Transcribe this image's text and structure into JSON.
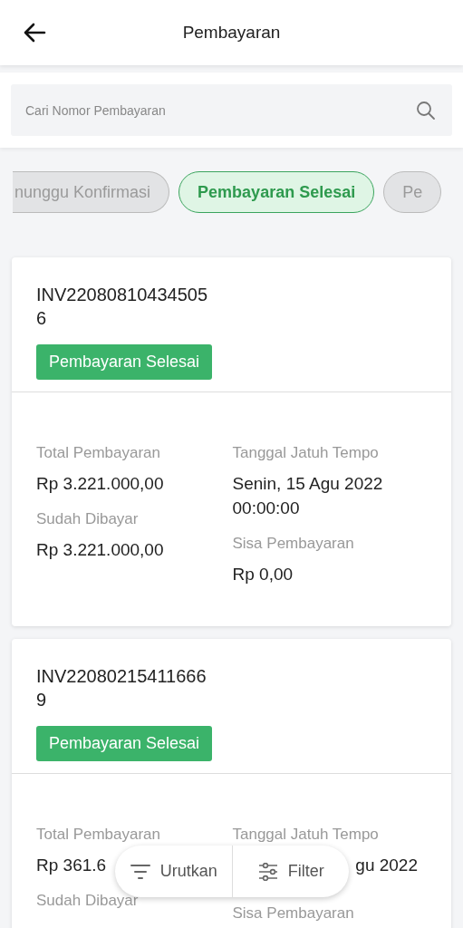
{
  "header": {
    "title": "Pembayaran"
  },
  "search": {
    "placeholder": "Cari Nomor Pembayaran"
  },
  "chips": [
    {
      "label": "nunggu Konfirmasi",
      "selected": false
    },
    {
      "label": "Pembayaran Selesai",
      "selected": true
    },
    {
      "label": "Pe",
      "selected": false
    }
  ],
  "cards": [
    {
      "invoice": "INV220808104345056",
      "status": "Pembayaran Selesai",
      "left": [
        {
          "label": "Total Pembayaran",
          "value": "Rp 3.221.000,00"
        },
        {
          "label": "Sudah Dibayar",
          "value": "Rp 3.221.000,00"
        }
      ],
      "right": [
        {
          "label": "Tanggal Jatuh Tempo",
          "value": "Senin, 15 Agu 2022 00:00:00",
          "kind": "full"
        },
        {
          "label": "Sisa Pembayaran",
          "value": "Rp 0,00",
          "kind": "full"
        }
      ]
    },
    {
      "invoice": "INV220802154116669",
      "status": "Pembayaran Selesai",
      "left": [
        {
          "label": "Total Pembayaran",
          "value": "Rp 361.6"
        },
        {
          "label": "Sudah Dibayar"
        }
      ],
      "right": [
        {
          "label": "Tanggal Jatuh Tempo",
          "value": "gu 2022",
          "kind": "partial"
        },
        {
          "label": "Sisa Pembayaran"
        }
      ]
    }
  ],
  "actions": [
    {
      "kind": "sort",
      "label": "Urutkan"
    },
    {
      "kind": "filter",
      "label": "Filter"
    }
  ]
}
